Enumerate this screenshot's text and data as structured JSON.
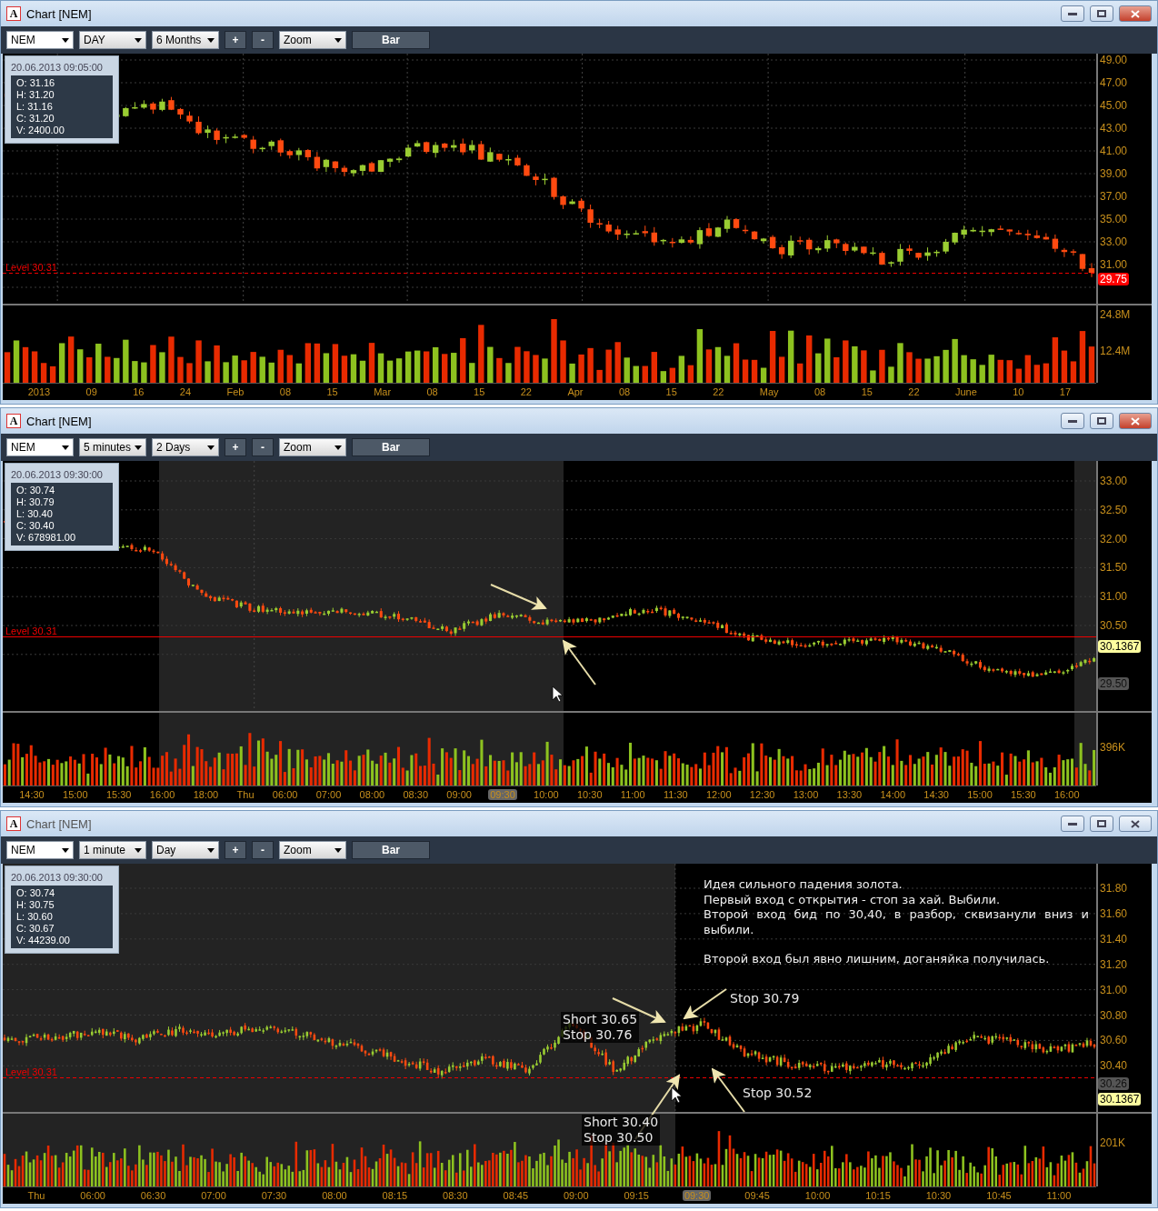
{
  "windows": [
    {
      "title": "Chart [NEM]",
      "icon_letter": "A",
      "active": true,
      "toolbar": [
        {
          "kind": "symbol",
          "label": "NEM"
        },
        {
          "kind": "dropdown",
          "label": "DAY"
        },
        {
          "kind": "dropdown",
          "label": "6 Months"
        },
        {
          "kind": "button",
          "label": "+"
        },
        {
          "kind": "button",
          "label": "-"
        },
        {
          "kind": "dropdown",
          "label": "Zoom"
        },
        {
          "kind": "wide",
          "label": "Bar"
        }
      ],
      "info": {
        "datetime": "20.06.2013 09:05:00",
        "lines": [
          "O: 31.16",
          "H: 31.20",
          "L: 31.16",
          "C: 31.20",
          "V: 2400.00"
        ]
      },
      "price_axis": [
        "49.00",
        "47.00",
        "45.00",
        "43.00",
        "41.00",
        "39.00",
        "37.00",
        "35.00",
        "33.00",
        "31.00"
      ],
      "badges": [
        {
          "kind": "last",
          "label": "29.75"
        }
      ],
      "level": "Level 30.31",
      "volume_axis": [
        "24.8M",
        "12.4M"
      ],
      "time_axis": [
        {
          "label": "2013",
          "current": false
        },
        {
          "label": "09",
          "current": false
        },
        {
          "label": "16",
          "current": false
        },
        {
          "label": "24",
          "current": false
        },
        {
          "label": "Feb",
          "current": false
        },
        {
          "label": "08",
          "current": false
        },
        {
          "label": "15",
          "current": false
        },
        {
          "label": "Mar",
          "current": false
        },
        {
          "label": "08",
          "current": false
        },
        {
          "label": "15",
          "current": false
        },
        {
          "label": "22",
          "current": false
        },
        {
          "label": "Apr",
          "current": false
        },
        {
          "label": "08",
          "current": false
        },
        {
          "label": "15",
          "current": false
        },
        {
          "label": "22",
          "current": false
        },
        {
          "label": "May",
          "current": false
        },
        {
          "label": "08",
          "current": false
        },
        {
          "label": "15",
          "current": false
        },
        {
          "label": "22",
          "current": false
        },
        {
          "label": "June",
          "current": false
        },
        {
          "label": "10",
          "current": false
        },
        {
          "label": "17",
          "current": false
        }
      ]
    },
    {
      "title": "Chart [NEM]",
      "icon_letter": "A",
      "active": true,
      "toolbar": [
        {
          "kind": "symbol",
          "label": "NEM"
        },
        {
          "kind": "dropdown",
          "label": "5 minutes"
        },
        {
          "kind": "dropdown",
          "label": "2 Days"
        },
        {
          "kind": "button",
          "label": "+"
        },
        {
          "kind": "button",
          "label": "-"
        },
        {
          "kind": "dropdown",
          "label": "Zoom"
        },
        {
          "kind": "wide",
          "label": "Bar"
        }
      ],
      "info": {
        "datetime": "20.06.2013 09:30:00",
        "lines": [
          "O: 30.74",
          "H: 30.79",
          "L: 30.40",
          "C: 30.40",
          "V: 678981.00"
        ]
      },
      "price_axis": [
        "33.00",
        "32.50",
        "32.00",
        "31.50",
        "31.00",
        "30.50"
      ],
      "badges": [
        {
          "kind": "last",
          "label": "30.1367"
        },
        {
          "kind": "marker",
          "label": "29.50"
        }
      ],
      "level": "Level 30.31",
      "volume_axis": [
        "396K"
      ],
      "time_axis": [
        {
          "label": "14:30",
          "current": false
        },
        {
          "label": "15:00",
          "current": false
        },
        {
          "label": "15:30",
          "current": false
        },
        {
          "label": "16:00",
          "current": false
        },
        {
          "label": "18:00",
          "current": false
        },
        {
          "label": "Thu",
          "current": false
        },
        {
          "label": "06:00",
          "current": false
        },
        {
          "label": "07:00",
          "current": false
        },
        {
          "label": "08:00",
          "current": false
        },
        {
          "label": "08:30",
          "current": false
        },
        {
          "label": "09:00",
          "current": false
        },
        {
          "label": "09:30",
          "current": true
        },
        {
          "label": "10:00",
          "current": false
        },
        {
          "label": "10:30",
          "current": false
        },
        {
          "label": "11:00",
          "current": false
        },
        {
          "label": "11:30",
          "current": false
        },
        {
          "label": "12:00",
          "current": false
        },
        {
          "label": "12:30",
          "current": false
        },
        {
          "label": "13:00",
          "current": false
        },
        {
          "label": "13:30",
          "current": false
        },
        {
          "label": "14:00",
          "current": false
        },
        {
          "label": "14:30",
          "current": false
        },
        {
          "label": "15:00",
          "current": false
        },
        {
          "label": "15:30",
          "current": false
        },
        {
          "label": "16:00",
          "current": false
        }
      ]
    },
    {
      "title": "Chart [NEM]",
      "icon_letter": "A",
      "active": false,
      "toolbar": [
        {
          "kind": "symbol",
          "label": "NEM"
        },
        {
          "kind": "dropdown",
          "label": "1 minute"
        },
        {
          "kind": "dropdown",
          "label": "Day"
        },
        {
          "kind": "button",
          "label": "+"
        },
        {
          "kind": "button",
          "label": "-"
        },
        {
          "kind": "dropdown",
          "label": "Zoom"
        },
        {
          "kind": "wide",
          "label": "Bar"
        }
      ],
      "info": {
        "datetime": "20.06.2013 09:30:00",
        "lines": [
          "O: 30.74",
          "H: 30.75",
          "L: 30.60",
          "C: 30.67",
          "V: 44239.00"
        ]
      },
      "price_axis": [
        "31.80",
        "31.60",
        "31.40",
        "31.20",
        "31.00",
        "30.80",
        "30.60",
        "30.40"
      ],
      "badges": [
        {
          "kind": "marker",
          "label": "30.26"
        },
        {
          "kind": "last",
          "label": "30.1367"
        }
      ],
      "level": "Level 30.31",
      "volume_axis": [
        "201K"
      ],
      "notes": [
        "Идея сильного падения золота.",
        "Первый вход с открытия - стоп за хай. Выбили.",
        "Второй вход бид по 30,40, в разбор, сквизанули вниз и выбили.",
        "Второй вход был явно лишним, доганяйка получилась."
      ],
      "annotations": [
        [
          "Short 30.65",
          "Stop 30.76"
        ],
        [
          "Stop 30.79"
        ],
        [
          "Stop 30.52"
        ],
        [
          "Short 30.40",
          "Stop 30.50"
        ]
      ],
      "time_axis": [
        {
          "label": "Thu",
          "current": false
        },
        {
          "label": "06:00",
          "current": false
        },
        {
          "label": "06:30",
          "current": false
        },
        {
          "label": "07:00",
          "current": false
        },
        {
          "label": "07:30",
          "current": false
        },
        {
          "label": "08:00",
          "current": false
        },
        {
          "label": "08:15",
          "current": false
        },
        {
          "label": "08:30",
          "current": false
        },
        {
          "label": "08:45",
          "current": false
        },
        {
          "label": "09:00",
          "current": false
        },
        {
          "label": "09:15",
          "current": false
        },
        {
          "label": "09:30",
          "current": true
        },
        {
          "label": "09:45",
          "current": false
        },
        {
          "label": "10:00",
          "current": false
        },
        {
          "label": "10:15",
          "current": false
        },
        {
          "label": "10:30",
          "current": false
        },
        {
          "label": "10:45",
          "current": false
        },
        {
          "label": "11:00",
          "current": false
        }
      ]
    }
  ]
}
